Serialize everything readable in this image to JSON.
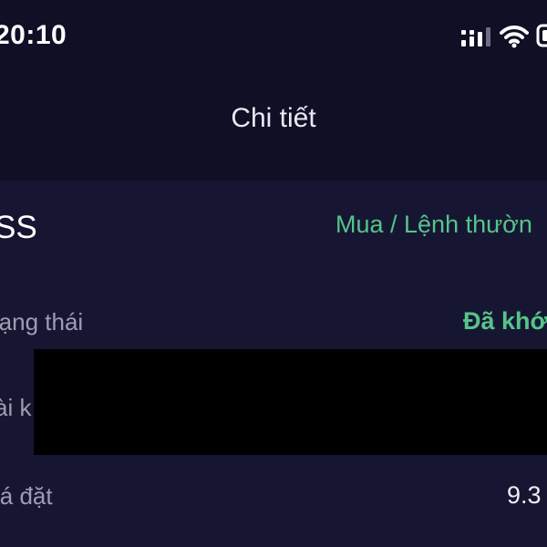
{
  "status_bar": {
    "time": "20:10",
    "icons": [
      "signal-icon",
      "wifi-icon",
      "battery-icon"
    ]
  },
  "header": {
    "title": "Chi tiết"
  },
  "order": {
    "symbol": "SS",
    "order_type": "Mua / Lệnh thườn",
    "rows": [
      {
        "label": "rạng thái",
        "value": "Đã khớ"
      },
      {
        "label": "ài k",
        "value": ""
      },
      {
        "label": "iá đặt",
        "value": "9.3"
      }
    ]
  },
  "colors": {
    "header_background": "#0f0f26",
    "content_background": "#161633",
    "accent_green": "#55c48a",
    "label_gray": "#9d9db1",
    "redaction": "#000000"
  }
}
